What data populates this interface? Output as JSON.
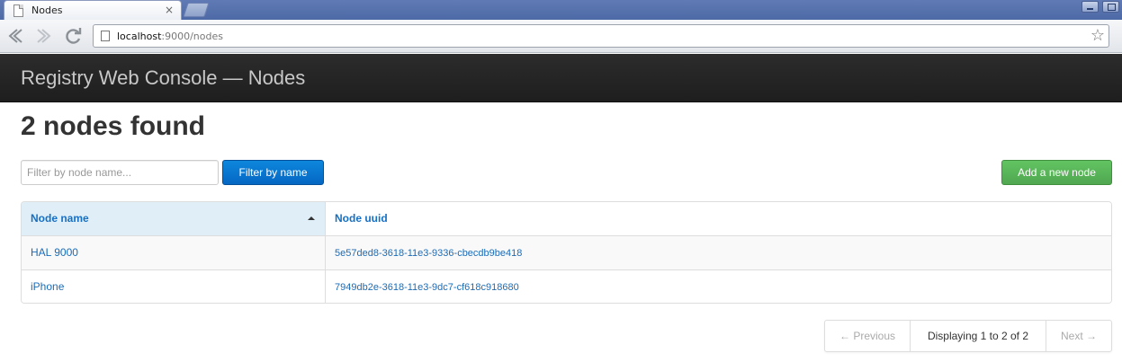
{
  "browser": {
    "tab_title": "Nodes",
    "tab_close": "×",
    "url_host": "localhost",
    "url_rest": ":9000/nodes",
    "icons": [
      "back-arrow-icon",
      "forward-arrow-icon",
      "reload-icon",
      "page-icon",
      "bookmark-star-icon"
    ]
  },
  "app": {
    "brand": "Registry Web Console — Nodes",
    "heading": "2 nodes found",
    "filter": {
      "placeholder": "Filter by node name...",
      "button_label": "Filter by name"
    },
    "add_button_label": "Add a new node",
    "table": {
      "columns": [
        "Node name",
        "Node uuid"
      ],
      "sorted_column": "Node name",
      "rows": [
        {
          "name": "HAL 9000",
          "uuid": "5e57ded8-3618-11e3-9336-cbecdb9be418"
        },
        {
          "name": "iPhone",
          "uuid": "7949db2e-3618-11e3-9dc7-cf618c918680"
        }
      ]
    },
    "pagination": {
      "previous": "← Previous",
      "info": "Displaying 1 to 2 of 2",
      "next": "Next →"
    }
  },
  "colors": {
    "appbar": "#222222",
    "primary_button": "#0567c3",
    "success_button": "#5bb75b",
    "link": "#1a6cb8",
    "sorted_header_bg": "#dfeef7"
  }
}
